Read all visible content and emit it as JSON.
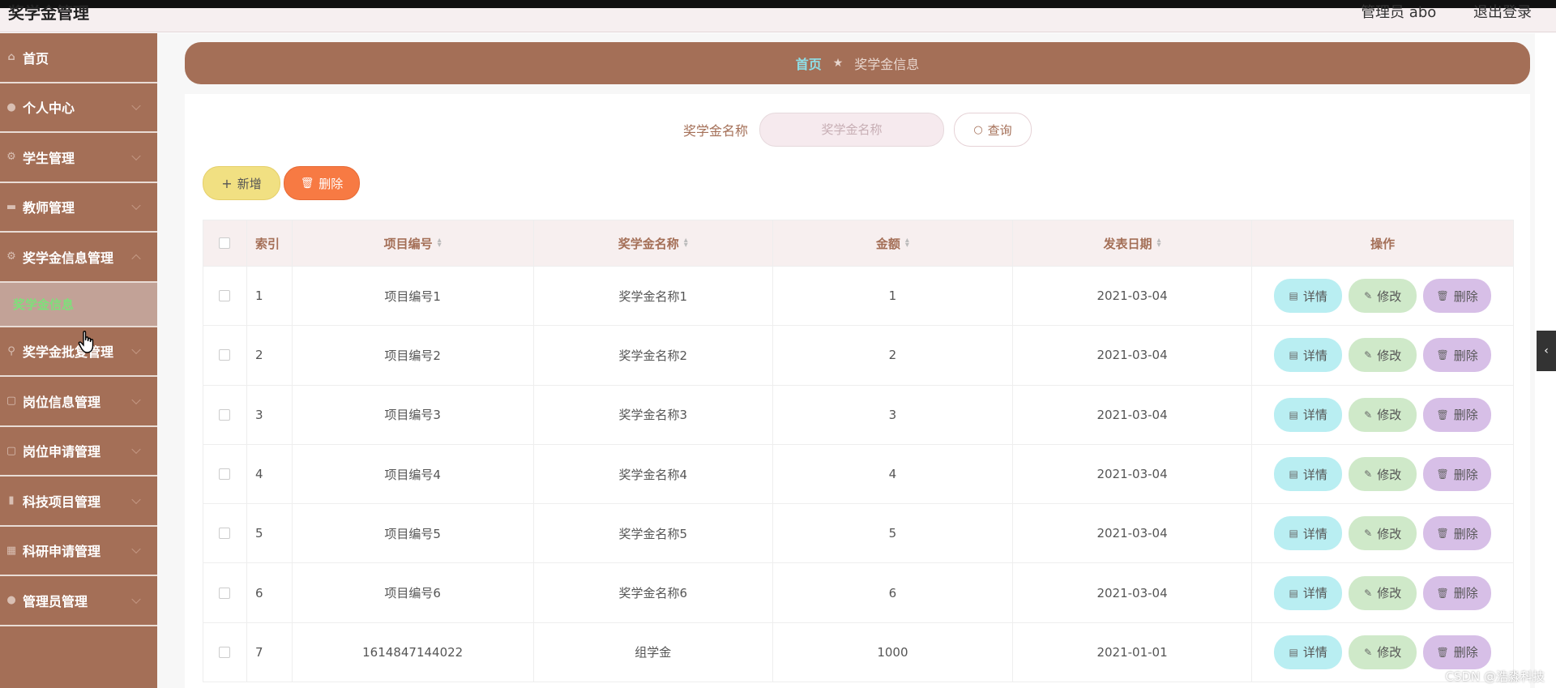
{
  "header": {
    "title": "奖学金管理",
    "user": "管理员 abo",
    "logout": "退出登录"
  },
  "sidebar": {
    "items": [
      {
        "label": "首页",
        "icon": "home-icon"
      },
      {
        "label": "个人中心",
        "icon": "user-icon"
      },
      {
        "label": "学生管理",
        "icon": "gear-icon"
      },
      {
        "label": "教师管理",
        "icon": "monitor-icon"
      },
      {
        "label": "奖学金信息管理",
        "icon": "settings-icon"
      },
      {
        "label": "奖学金批复管理",
        "icon": "pin-icon"
      },
      {
        "label": "岗位信息管理",
        "icon": "document-icon"
      },
      {
        "label": "岗位申请管理",
        "icon": "document-icon"
      },
      {
        "label": "科技项目管理",
        "icon": "chart-icon"
      },
      {
        "label": "科研申请管理",
        "icon": "grid-icon"
      },
      {
        "label": "管理员管理",
        "icon": "user-icon"
      }
    ],
    "sub_active": "奖学金信息"
  },
  "breadcrumb": {
    "home": "首页",
    "current": "奖学金信息"
  },
  "search": {
    "label": "奖学金名称",
    "placeholder": "奖学金名称",
    "button": "查询"
  },
  "toolbar": {
    "add": "新增",
    "delete": "删除"
  },
  "table": {
    "headers": [
      "索引",
      "项目编号",
      "奖学金名称",
      "金额",
      "发表日期",
      "操作"
    ],
    "rows": [
      [
        "1",
        "项目编号1",
        "奖学金名称1",
        "1",
        "2021-03-04"
      ],
      [
        "2",
        "项目编号2",
        "奖学金名称2",
        "2",
        "2021-03-04"
      ],
      [
        "3",
        "项目编号3",
        "奖学金名称3",
        "3",
        "2021-03-04"
      ],
      [
        "4",
        "项目编号4",
        "奖学金名称4",
        "4",
        "2021-03-04"
      ],
      [
        "5",
        "项目编号5",
        "奖学金名称5",
        "5",
        "2021-03-04"
      ],
      [
        "6",
        "项目编号6",
        "奖学金名称6",
        "6",
        "2021-03-04"
      ],
      [
        "7",
        "1614847144022",
        "组学金",
        "1000",
        "2021-01-01"
      ]
    ],
    "actions": {
      "detail": "详情",
      "edit": "修改",
      "delete": "删除"
    }
  },
  "watermark": "CSDN @浩淼科技",
  "colors": {
    "brand": "#a46f57",
    "detail": "#b9eef2",
    "edit": "#cfe9c9",
    "remove": "#d7bfe7",
    "add": "#f1e082",
    "delete": "#f77a43"
  }
}
